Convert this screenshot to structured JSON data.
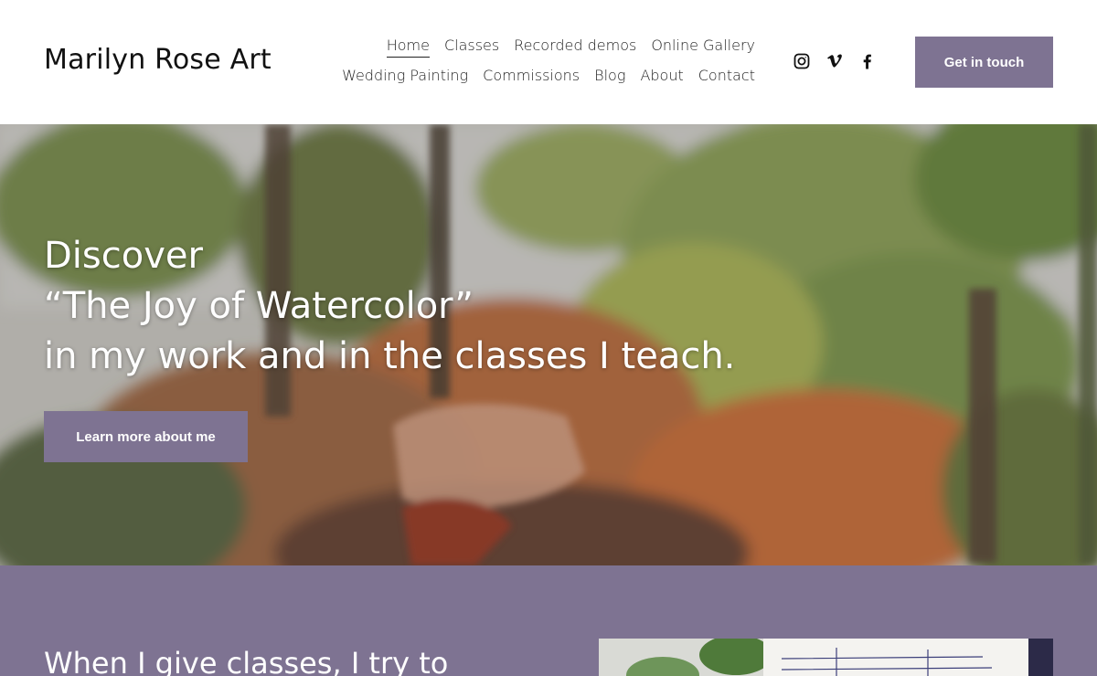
{
  "header": {
    "brand": "Marilyn Rose Art",
    "nav_row1": [
      "Home",
      "Classes",
      "Recorded demos",
      "Online Gallery"
    ],
    "nav_row2": [
      "Wedding Painting",
      "Commissions",
      "Blog",
      "About",
      "Contact"
    ],
    "active_nav": "Home",
    "social_icons": [
      "instagram-icon",
      "vimeo-icon",
      "facebook-icon"
    ],
    "cta_label": "Get in touch"
  },
  "hero": {
    "line1": "Discover",
    "line2": "“The Joy of Watercolor”",
    "line3": "in my work and in the classes I teach.",
    "button_label": "Learn more about me"
  },
  "section2": {
    "heading": "When I give classes, I try to"
  },
  "colors": {
    "accent": "#7e7392",
    "text": "#111111",
    "hero_text": "#ffffff"
  }
}
